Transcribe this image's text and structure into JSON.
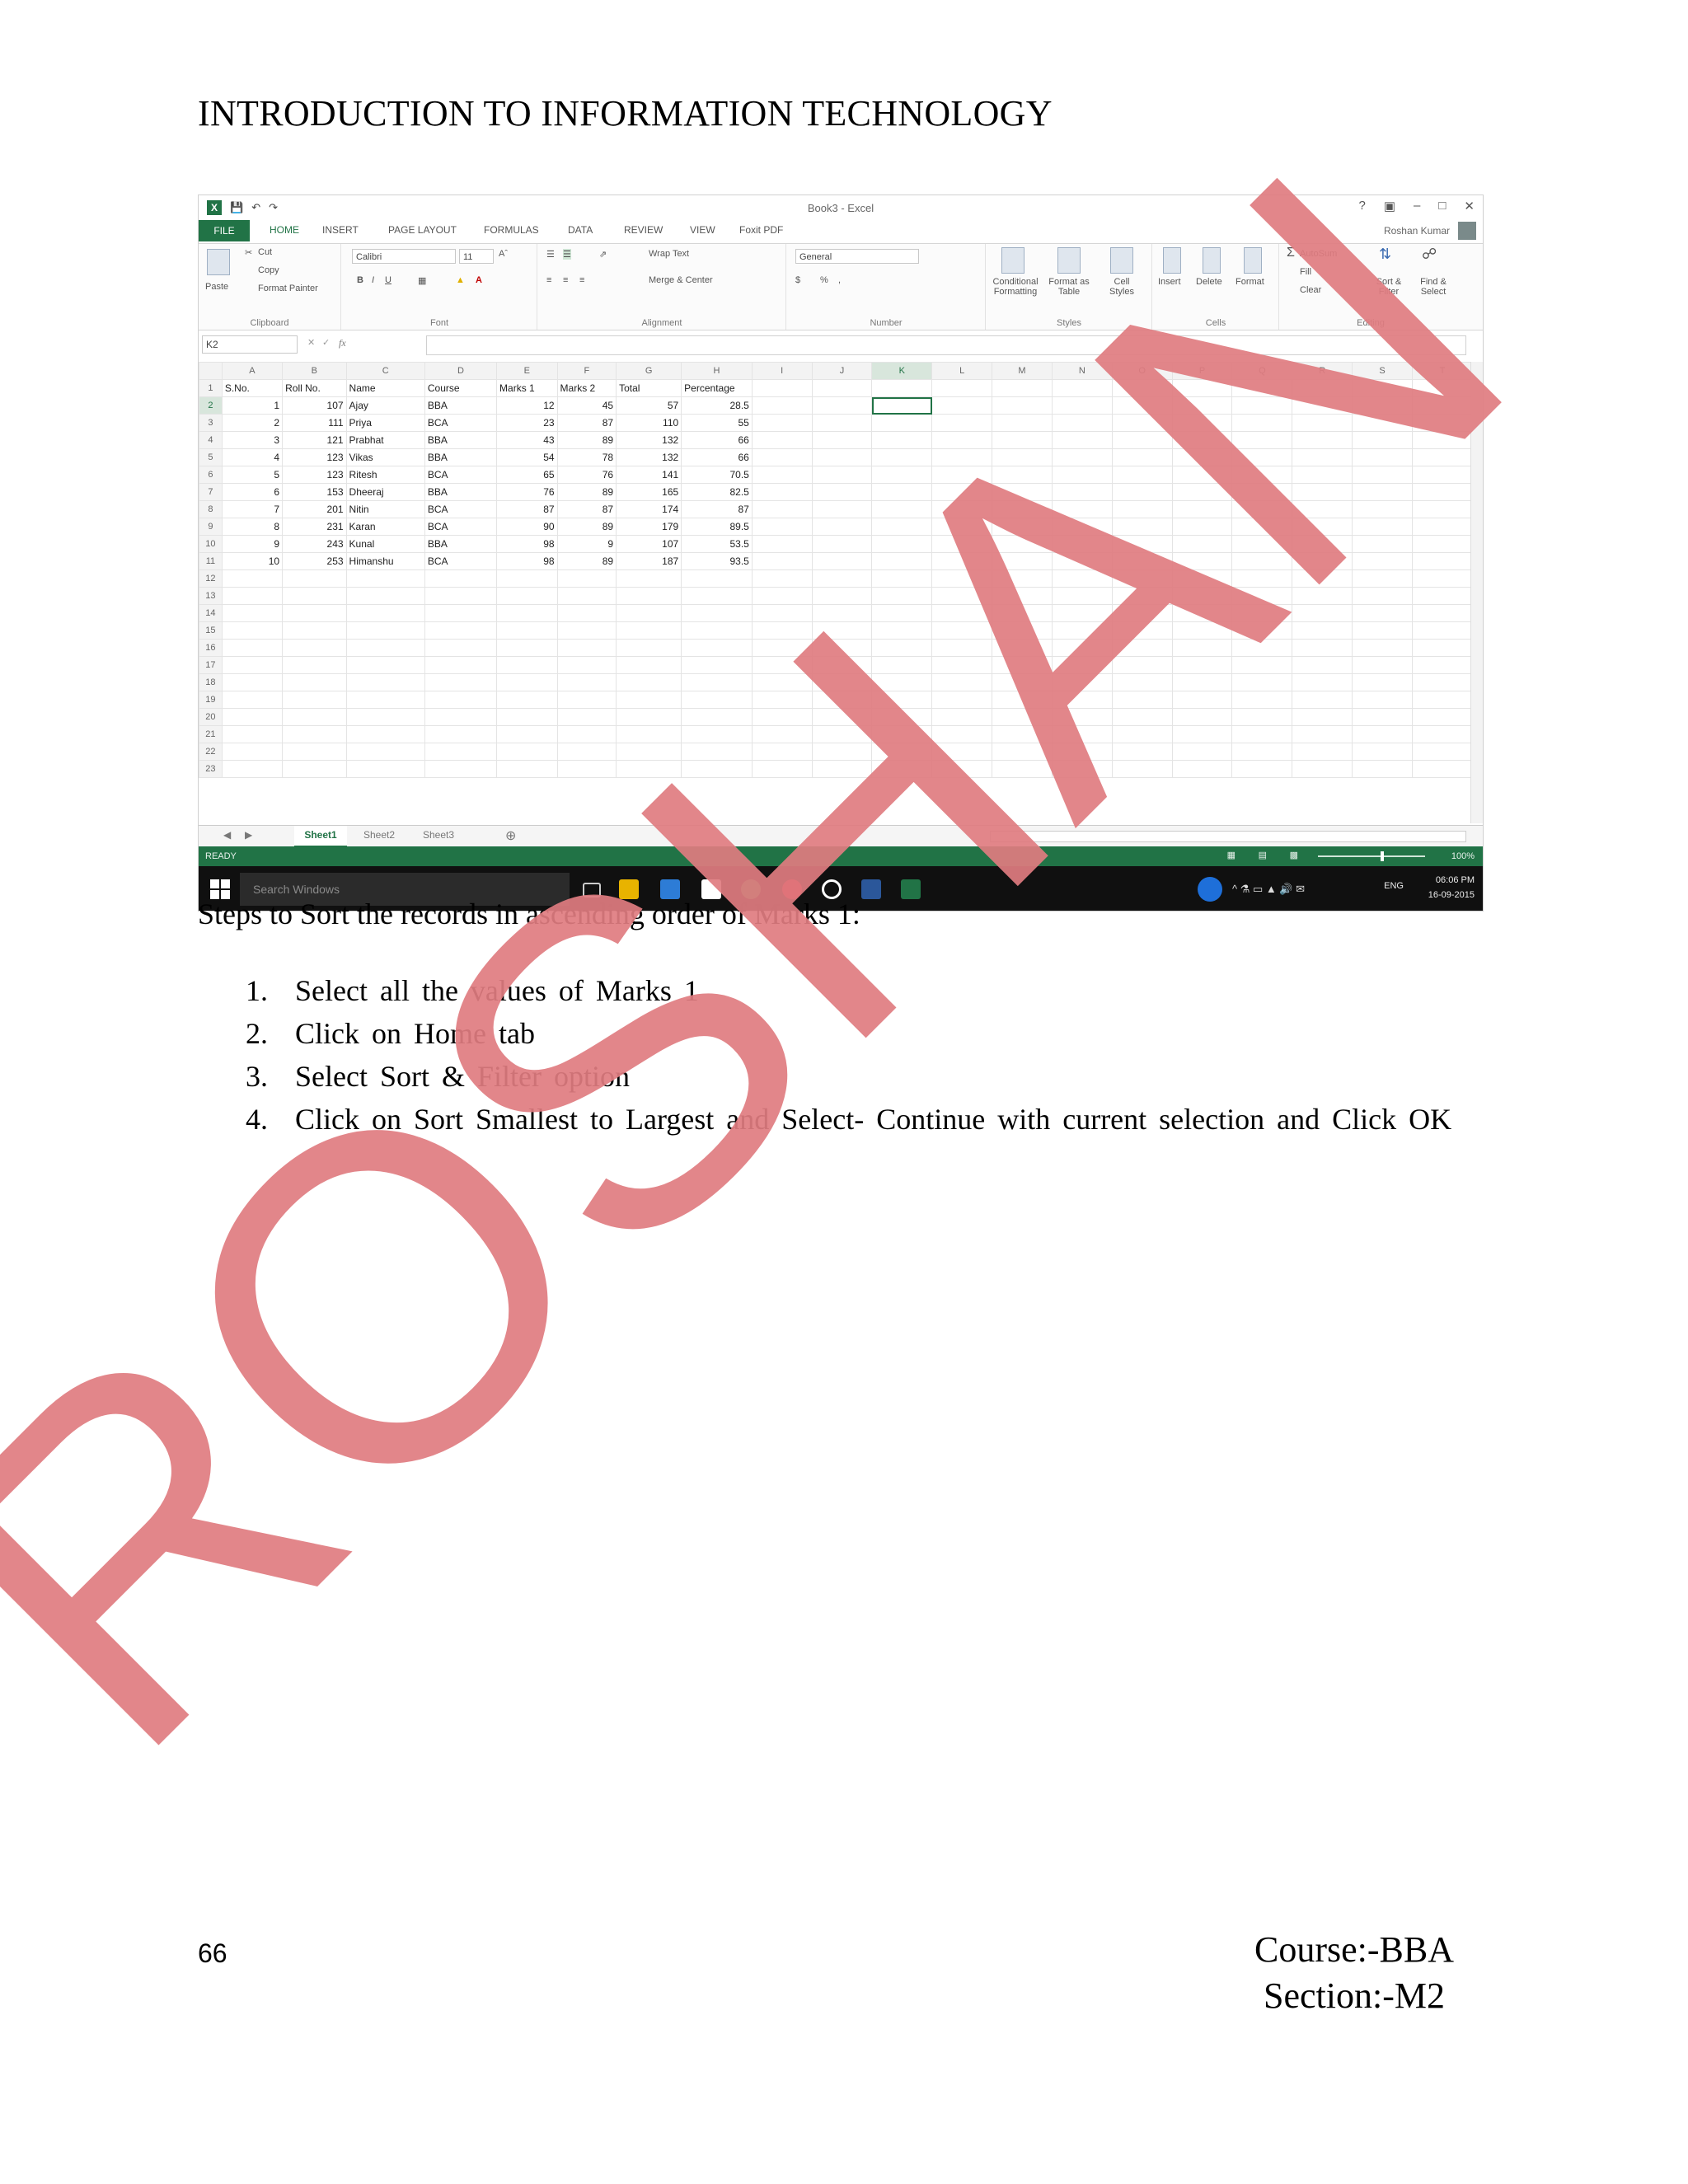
{
  "header": {
    "title": "INTRODUCTION TO INFORMATION TECHNOLOGY"
  },
  "excel": {
    "window_title": "Book3 - Excel",
    "window_controls": [
      "?",
      "▣",
      "–",
      "□",
      "✕"
    ],
    "tabs": [
      "FILE",
      "HOME",
      "INSERT",
      "PAGE LAYOUT",
      "FORMULAS",
      "DATA",
      "REVIEW",
      "VIEW",
      "Foxit PDF"
    ],
    "user": "Roshan Kumar",
    "ribbon": {
      "clipboard": {
        "paste": "Paste",
        "cut": "Cut",
        "copy": "Copy",
        "format_painter": "Format Painter",
        "label": "Clipboard"
      },
      "font": {
        "name": "Calibri",
        "size": "11",
        "label": "Font"
      },
      "alignment": {
        "wrap_text": "Wrap Text",
        "merge_center": "Merge & Center",
        "label": "Alignment"
      },
      "number": {
        "format": "General",
        "label": "Number"
      },
      "styles": {
        "conditional": "Conditional Formatting",
        "format_table": "Format as Table",
        "cell_styles": "Cell Styles",
        "label": "Styles"
      },
      "cells": {
        "insert": "Insert",
        "delete": "Delete",
        "format": "Format",
        "label": "Cells"
      },
      "editing": {
        "autosum": "AutoSum",
        "fill": "Fill",
        "clear": "Clear",
        "sort_filter": "Sort & Filter",
        "find_select": "Find & Select",
        "label": "Editing"
      }
    },
    "name_box": "K2",
    "fx": "fx",
    "columns": [
      "A",
      "B",
      "C",
      "D",
      "E",
      "F",
      "G",
      "H",
      "I",
      "J",
      "K",
      "L",
      "M",
      "N",
      "O",
      "P",
      "Q",
      "R",
      "S",
      "T"
    ],
    "headers": [
      "S.No.",
      "Roll No.",
      "Name",
      "Course",
      "Marks 1",
      "Marks 2",
      "Total",
      "Percentage"
    ],
    "rows": [
      [
        "1",
        "107",
        "Ajay",
        "BBA",
        "12",
        "45",
        "57",
        "28.5"
      ],
      [
        "2",
        "111",
        "Priya",
        "BCA",
        "23",
        "87",
        "110",
        "55"
      ],
      [
        "3",
        "121",
        "Prabhat",
        "BBA",
        "43",
        "89",
        "132",
        "66"
      ],
      [
        "4",
        "123",
        "Vikas",
        "BBA",
        "54",
        "78",
        "132",
        "66"
      ],
      [
        "5",
        "123",
        "Ritesh",
        "BCA",
        "65",
        "76",
        "141",
        "70.5"
      ],
      [
        "6",
        "153",
        "Dheeraj",
        "BBA",
        "76",
        "89",
        "165",
        "82.5"
      ],
      [
        "7",
        "201",
        "Nitin",
        "BCA",
        "87",
        "87",
        "174",
        "87"
      ],
      [
        "8",
        "231",
        "Karan",
        "BCA",
        "90",
        "89",
        "179",
        "89.5"
      ],
      [
        "9",
        "243",
        "Kunal",
        "BBA",
        "98",
        "9",
        "107",
        "53.5"
      ],
      [
        "10",
        "253",
        "Himanshu",
        "BCA",
        "98",
        "89",
        "187",
        "93.5"
      ]
    ],
    "row_numbers": [
      "1",
      "2",
      "3",
      "4",
      "5",
      "6",
      "7",
      "8",
      "9",
      "10",
      "11",
      "12",
      "13",
      "14",
      "15",
      "16",
      "17",
      "18",
      "19",
      "20",
      "21",
      "22",
      "23"
    ],
    "sheet_tabs": [
      "Sheet1",
      "Sheet2",
      "Sheet3"
    ],
    "status": "READY",
    "zoom": "100%",
    "search_placeholder": "Search Windows",
    "tray_lang": "ENG",
    "clock_time": "06:06 PM",
    "clock_date": "16-09-2015"
  },
  "steps_heading": "Steps to Sort the records in ascending  order of Marks 1:",
  "steps": [
    {
      "n": "1.",
      "text": "Select all the values  of Marks 1"
    },
    {
      "n": "2.",
      "text": "Click  on Home tab"
    },
    {
      "n": "3.",
      "text": "Select Sort & Filter  option"
    },
    {
      "n": "4.",
      "text": "Click  on Sort Smallest  to Largest  and Select-  Continue  with  current  selection  and Click OK"
    }
  ],
  "footer": {
    "page_number": "66",
    "course": "Course:-BBA",
    "section": "Section:-M2"
  },
  "watermark": {
    "text": "ROSHAN",
    "color": "#e07c80"
  },
  "colors": {
    "excel_green": "#217346"
  }
}
